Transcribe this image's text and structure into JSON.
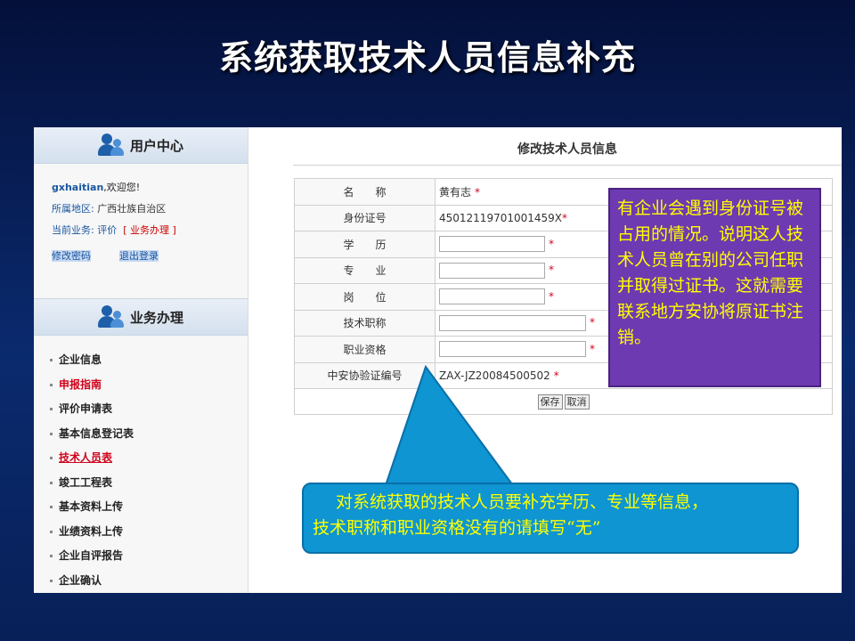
{
  "slide_title": "系统获取技术人员信息补充",
  "sidebar": {
    "user_center_title": "用户中心",
    "username": "gxhaitian",
    "welcome": ",欢迎您!",
    "region_label": "所属地区: ",
    "region_value": "广西壮族自治区",
    "business_label": "当前业务: 评价",
    "business_link": "[ 业务办理 ]",
    "change_password": "修改密码",
    "logout": "退出登录",
    "business_title": "业务办理",
    "menu": [
      {
        "label": "企业信息"
      },
      {
        "label": "申报指南"
      },
      {
        "label": "评价申请表"
      },
      {
        "label": "基本信息登记表"
      },
      {
        "label": "技术人员表"
      },
      {
        "label": "竣工工程表"
      },
      {
        "label": "基本资料上传"
      },
      {
        "label": "业绩资料上传"
      },
      {
        "label": "企业自评报告"
      },
      {
        "label": "企业确认"
      }
    ]
  },
  "main": {
    "title": "修改技术人员信息",
    "rows": [
      {
        "label": "名　　称",
        "value": "黄有志"
      },
      {
        "label": "身份证号",
        "value": "45012119701001459X"
      },
      {
        "label": "学　　历",
        "value": ""
      },
      {
        "label": "专　　业",
        "value": ""
      },
      {
        "label": "岗　　位",
        "value": ""
      },
      {
        "label": "技术职称",
        "value": ""
      },
      {
        "label": "职业资格",
        "value": ""
      },
      {
        "label": "中安协验证编号",
        "value": "ZAX-JZ20084500502"
      }
    ],
    "required_mark": "*",
    "save_label": "保存",
    "cancel_label": "取消"
  },
  "callout_purple": "有企业会遇到身份证号被占用的情况。说明这人技术人员曾在别的公司任职并取得过证书。这就需要联系地方安协将原证书注销。",
  "callout_blue": {
    "line1": "对系统获取的技术人员要补充学历、专业等信息，",
    "line2": "技术职称和职业资格没有的请填写“无”"
  },
  "colors": {
    "callout_purple_bg": "#6e3ab2",
    "callout_blue_bg": "#0e95d2",
    "callout_text": "#ffff00",
    "required_star": "#d0021b"
  }
}
